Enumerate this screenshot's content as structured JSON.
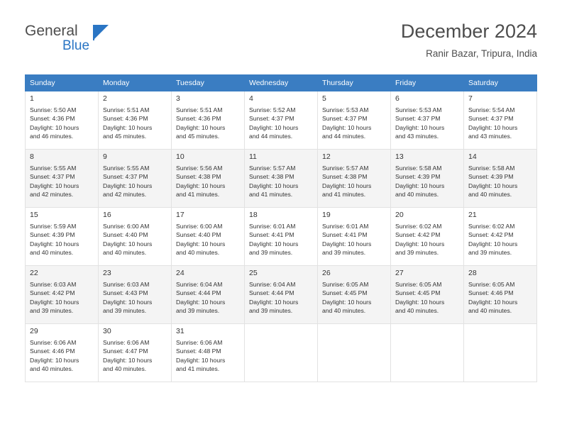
{
  "logo": {
    "word_general": "General",
    "word_blue": "Blue",
    "flag_icon": "blue-flag-icon"
  },
  "header": {
    "month_title": "December 2024",
    "location": "Ranir Bazar, Tripura, India"
  },
  "calendar": {
    "weekday_headers": [
      "Sunday",
      "Monday",
      "Tuesday",
      "Wednesday",
      "Thursday",
      "Friday",
      "Saturday"
    ],
    "accent_color": "#3a7dc2",
    "alt_row_color": "#f4f4f4",
    "weeks": [
      [
        {
          "day": "1",
          "sunrise": "Sunrise: 5:50 AM",
          "sunset": "Sunset: 4:36 PM",
          "daylight1": "Daylight: 10 hours",
          "daylight2": "and 46 minutes."
        },
        {
          "day": "2",
          "sunrise": "Sunrise: 5:51 AM",
          "sunset": "Sunset: 4:36 PM",
          "daylight1": "Daylight: 10 hours",
          "daylight2": "and 45 minutes."
        },
        {
          "day": "3",
          "sunrise": "Sunrise: 5:51 AM",
          "sunset": "Sunset: 4:36 PM",
          "daylight1": "Daylight: 10 hours",
          "daylight2": "and 45 minutes."
        },
        {
          "day": "4",
          "sunrise": "Sunrise: 5:52 AM",
          "sunset": "Sunset: 4:37 PM",
          "daylight1": "Daylight: 10 hours",
          "daylight2": "and 44 minutes."
        },
        {
          "day": "5",
          "sunrise": "Sunrise: 5:53 AM",
          "sunset": "Sunset: 4:37 PM",
          "daylight1": "Daylight: 10 hours",
          "daylight2": "and 44 minutes."
        },
        {
          "day": "6",
          "sunrise": "Sunrise: 5:53 AM",
          "sunset": "Sunset: 4:37 PM",
          "daylight1": "Daylight: 10 hours",
          "daylight2": "and 43 minutes."
        },
        {
          "day": "7",
          "sunrise": "Sunrise: 5:54 AM",
          "sunset": "Sunset: 4:37 PM",
          "daylight1": "Daylight: 10 hours",
          "daylight2": "and 43 minutes."
        }
      ],
      [
        {
          "day": "8",
          "sunrise": "Sunrise: 5:55 AM",
          "sunset": "Sunset: 4:37 PM",
          "daylight1": "Daylight: 10 hours",
          "daylight2": "and 42 minutes."
        },
        {
          "day": "9",
          "sunrise": "Sunrise: 5:55 AM",
          "sunset": "Sunset: 4:37 PM",
          "daylight1": "Daylight: 10 hours",
          "daylight2": "and 42 minutes."
        },
        {
          "day": "10",
          "sunrise": "Sunrise: 5:56 AM",
          "sunset": "Sunset: 4:38 PM",
          "daylight1": "Daylight: 10 hours",
          "daylight2": "and 41 minutes."
        },
        {
          "day": "11",
          "sunrise": "Sunrise: 5:57 AM",
          "sunset": "Sunset: 4:38 PM",
          "daylight1": "Daylight: 10 hours",
          "daylight2": "and 41 minutes."
        },
        {
          "day": "12",
          "sunrise": "Sunrise: 5:57 AM",
          "sunset": "Sunset: 4:38 PM",
          "daylight1": "Daylight: 10 hours",
          "daylight2": "and 41 minutes."
        },
        {
          "day": "13",
          "sunrise": "Sunrise: 5:58 AM",
          "sunset": "Sunset: 4:39 PM",
          "daylight1": "Daylight: 10 hours",
          "daylight2": "and 40 minutes."
        },
        {
          "day": "14",
          "sunrise": "Sunrise: 5:58 AM",
          "sunset": "Sunset: 4:39 PM",
          "daylight1": "Daylight: 10 hours",
          "daylight2": "and 40 minutes."
        }
      ],
      [
        {
          "day": "15",
          "sunrise": "Sunrise: 5:59 AM",
          "sunset": "Sunset: 4:39 PM",
          "daylight1": "Daylight: 10 hours",
          "daylight2": "and 40 minutes."
        },
        {
          "day": "16",
          "sunrise": "Sunrise: 6:00 AM",
          "sunset": "Sunset: 4:40 PM",
          "daylight1": "Daylight: 10 hours",
          "daylight2": "and 40 minutes."
        },
        {
          "day": "17",
          "sunrise": "Sunrise: 6:00 AM",
          "sunset": "Sunset: 4:40 PM",
          "daylight1": "Daylight: 10 hours",
          "daylight2": "and 40 minutes."
        },
        {
          "day": "18",
          "sunrise": "Sunrise: 6:01 AM",
          "sunset": "Sunset: 4:41 PM",
          "daylight1": "Daylight: 10 hours",
          "daylight2": "and 39 minutes."
        },
        {
          "day": "19",
          "sunrise": "Sunrise: 6:01 AM",
          "sunset": "Sunset: 4:41 PM",
          "daylight1": "Daylight: 10 hours",
          "daylight2": "and 39 minutes."
        },
        {
          "day": "20",
          "sunrise": "Sunrise: 6:02 AM",
          "sunset": "Sunset: 4:42 PM",
          "daylight1": "Daylight: 10 hours",
          "daylight2": "and 39 minutes."
        },
        {
          "day": "21",
          "sunrise": "Sunrise: 6:02 AM",
          "sunset": "Sunset: 4:42 PM",
          "daylight1": "Daylight: 10 hours",
          "daylight2": "and 39 minutes."
        }
      ],
      [
        {
          "day": "22",
          "sunrise": "Sunrise: 6:03 AM",
          "sunset": "Sunset: 4:42 PM",
          "daylight1": "Daylight: 10 hours",
          "daylight2": "and 39 minutes."
        },
        {
          "day": "23",
          "sunrise": "Sunrise: 6:03 AM",
          "sunset": "Sunset: 4:43 PM",
          "daylight1": "Daylight: 10 hours",
          "daylight2": "and 39 minutes."
        },
        {
          "day": "24",
          "sunrise": "Sunrise: 6:04 AM",
          "sunset": "Sunset: 4:44 PM",
          "daylight1": "Daylight: 10 hours",
          "daylight2": "and 39 minutes."
        },
        {
          "day": "25",
          "sunrise": "Sunrise: 6:04 AM",
          "sunset": "Sunset: 4:44 PM",
          "daylight1": "Daylight: 10 hours",
          "daylight2": "and 39 minutes."
        },
        {
          "day": "26",
          "sunrise": "Sunrise: 6:05 AM",
          "sunset": "Sunset: 4:45 PM",
          "daylight1": "Daylight: 10 hours",
          "daylight2": "and 40 minutes."
        },
        {
          "day": "27",
          "sunrise": "Sunrise: 6:05 AM",
          "sunset": "Sunset: 4:45 PM",
          "daylight1": "Daylight: 10 hours",
          "daylight2": "and 40 minutes."
        },
        {
          "day": "28",
          "sunrise": "Sunrise: 6:05 AM",
          "sunset": "Sunset: 4:46 PM",
          "daylight1": "Daylight: 10 hours",
          "daylight2": "and 40 minutes."
        }
      ],
      [
        {
          "day": "29",
          "sunrise": "Sunrise: 6:06 AM",
          "sunset": "Sunset: 4:46 PM",
          "daylight1": "Daylight: 10 hours",
          "daylight2": "and 40 minutes."
        },
        {
          "day": "30",
          "sunrise": "Sunrise: 6:06 AM",
          "sunset": "Sunset: 4:47 PM",
          "daylight1": "Daylight: 10 hours",
          "daylight2": "and 40 minutes."
        },
        {
          "day": "31",
          "sunrise": "Sunrise: 6:06 AM",
          "sunset": "Sunset: 4:48 PM",
          "daylight1": "Daylight: 10 hours",
          "daylight2": "and 41 minutes."
        },
        null,
        null,
        null,
        null
      ]
    ]
  }
}
